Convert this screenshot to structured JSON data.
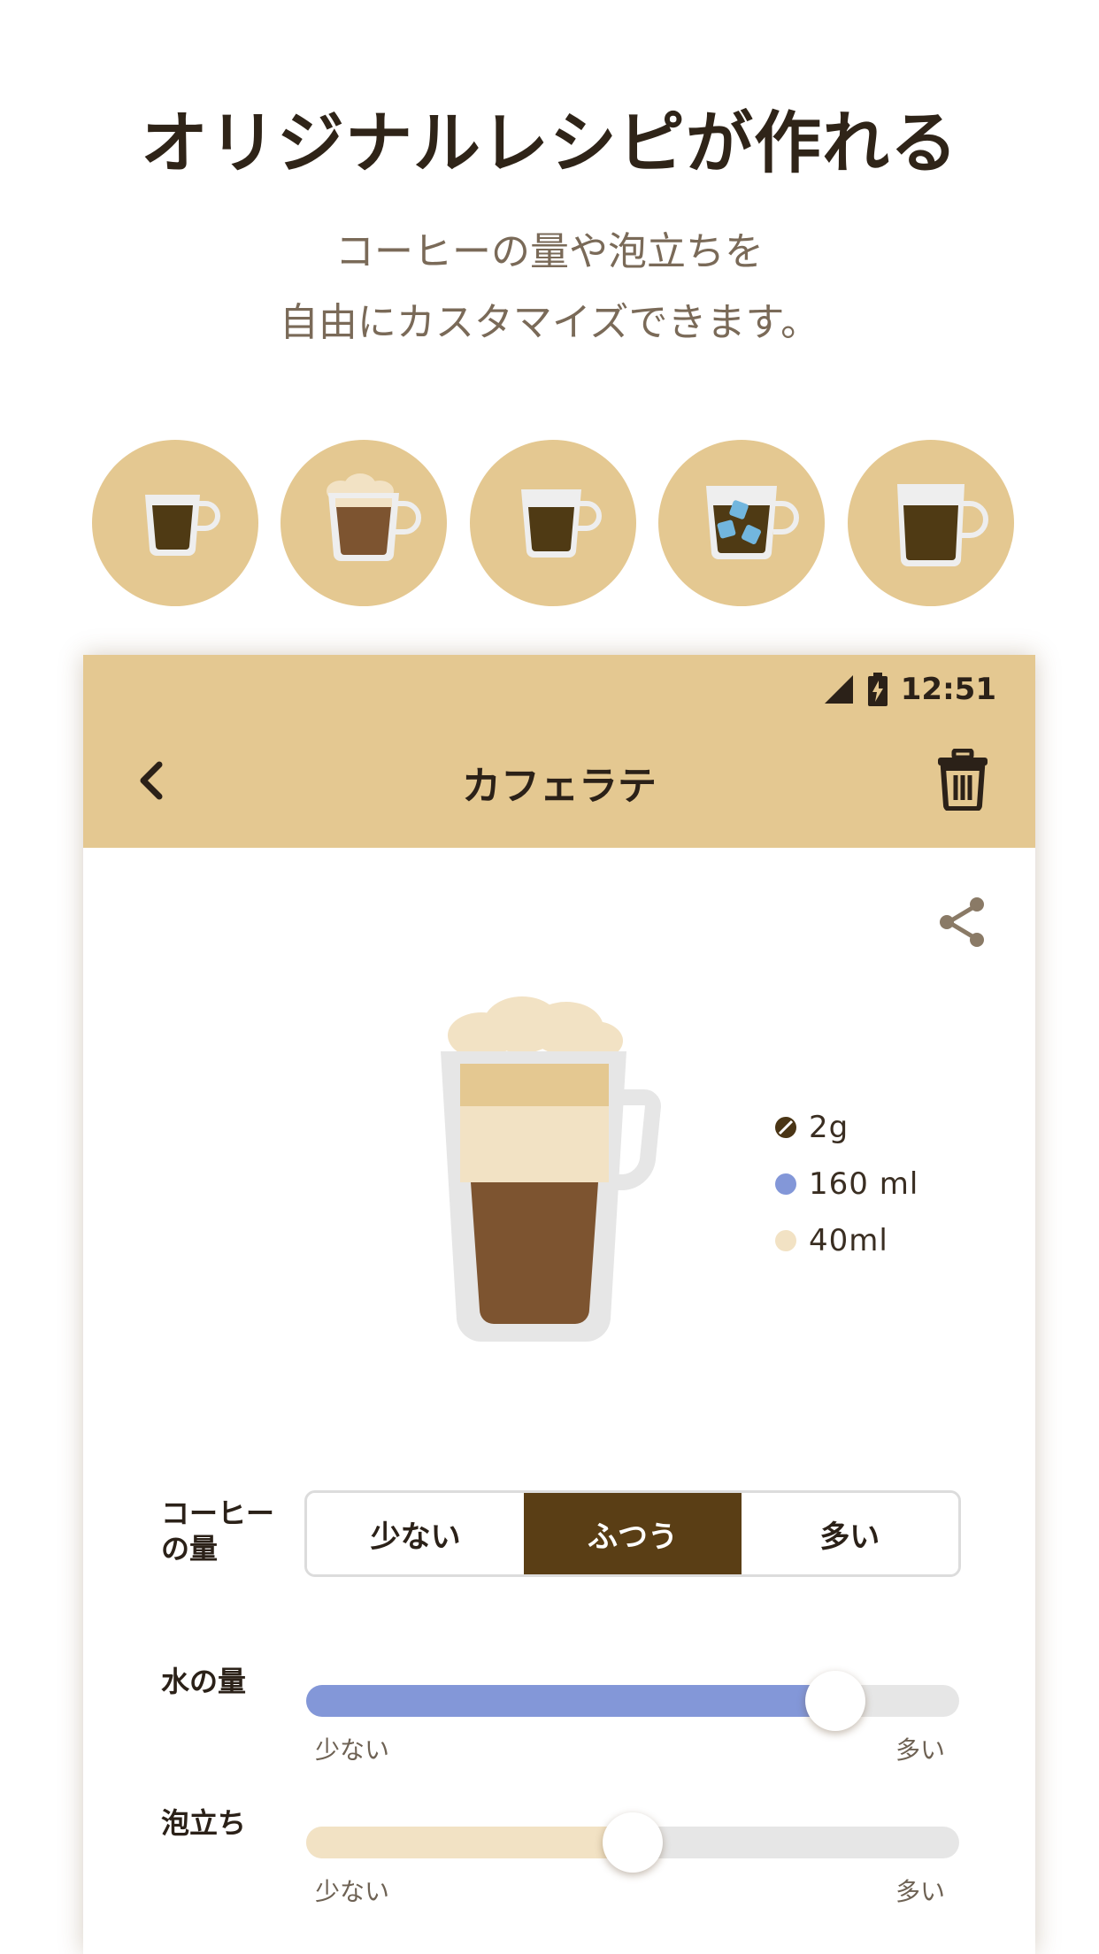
{
  "promo": {
    "headline": "オリジナルレシピが作れる",
    "subline_1": "コーヒーの量や泡立ちを",
    "subline_2": "自由にカスタマイズできます。"
  },
  "presets": [
    {
      "icon": "small-coffee-cup-icon"
    },
    {
      "icon": "foam-latte-cup-icon"
    },
    {
      "icon": "coffee-cup-icon"
    },
    {
      "icon": "iced-coffee-cup-icon"
    },
    {
      "icon": "tall-coffee-mug-icon"
    }
  ],
  "status_bar": {
    "time": "12:51"
  },
  "app_bar": {
    "title": "カフェラテ"
  },
  "legend": [
    {
      "value": "2g",
      "color": "#4a3515",
      "icon": "coffee-bean-icon"
    },
    {
      "value": "160 ml",
      "color": "#8397d8"
    },
    {
      "value": "40ml",
      "color": "#f2e2c4"
    }
  ],
  "coffee_amount": {
    "label_line1": "コーヒー",
    "label_line2": "の量",
    "options": [
      "少ない",
      "ふつう",
      "多い"
    ],
    "selected": "ふつう"
  },
  "water_amount": {
    "label": "水の量",
    "min_label": "少ない",
    "max_label": "多い",
    "level_percent": 81,
    "color": "#8397d8"
  },
  "foam": {
    "label": "泡立ち",
    "min_label": "少ない",
    "max_label": "多い",
    "level_percent": 50,
    "color": "#f2e2c4"
  },
  "colors": {
    "accent": "#e4c891",
    "dark_brown": "#5a3e15",
    "coffee": "#7d5430",
    "milk": "#f2e2c4"
  }
}
